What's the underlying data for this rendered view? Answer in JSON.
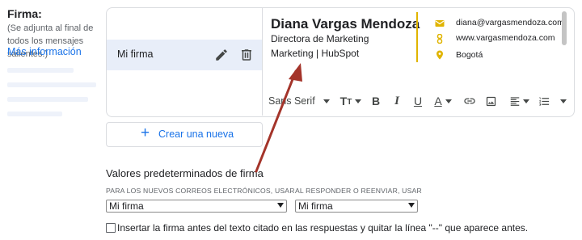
{
  "firma": {
    "title": "Firma:",
    "description": "(Se adjunta al final de todos los mensajes salientes.)",
    "more_info": "Más información"
  },
  "signature_list": {
    "items": [
      {
        "label": "Mi firma"
      }
    ],
    "edit_icon": "pencil-icon",
    "delete_icon": "trash-icon"
  },
  "signature": {
    "name": "Diana Vargas Mendoza",
    "role": "Directora de Marketing",
    "company": "Marketing | HubSpot",
    "email": "diana@vargasmendoza.com",
    "website": "www.vargasmendoza.com",
    "location": "Bogotá",
    "accent_color": "#e0b400"
  },
  "toolbar": {
    "font": "Sans Serif",
    "size_icon": "text-size-icon",
    "bold": "B",
    "italic": "I",
    "underline": "U",
    "text_color": "A",
    "link_icon": "link-icon",
    "image_icon": "image-icon",
    "align_icon": "align-left-icon",
    "list_icon": "numbered-list-icon",
    "more_icon": "more-icon"
  },
  "create_button": {
    "label": "Crear una nueva"
  },
  "defaults": {
    "title": "Valores predeterminados de firma",
    "new_label": "PARA LOS NUEVOS CORREOS ELECTRÓNICOS, USAR",
    "new_value": "Mi firma",
    "reply_label": "AL RESPONDER O REENVIAR, USAR",
    "reply_value": "Mi firma"
  },
  "insert_option": {
    "label": "Insertar la firma antes del texto citado en las respuestas y quitar la línea \"--\" que aparece antes.",
    "checked": false
  },
  "colors": {
    "link": "#1a73e8",
    "selected_row": "#e8eef9",
    "arrow": "#a4342a"
  }
}
